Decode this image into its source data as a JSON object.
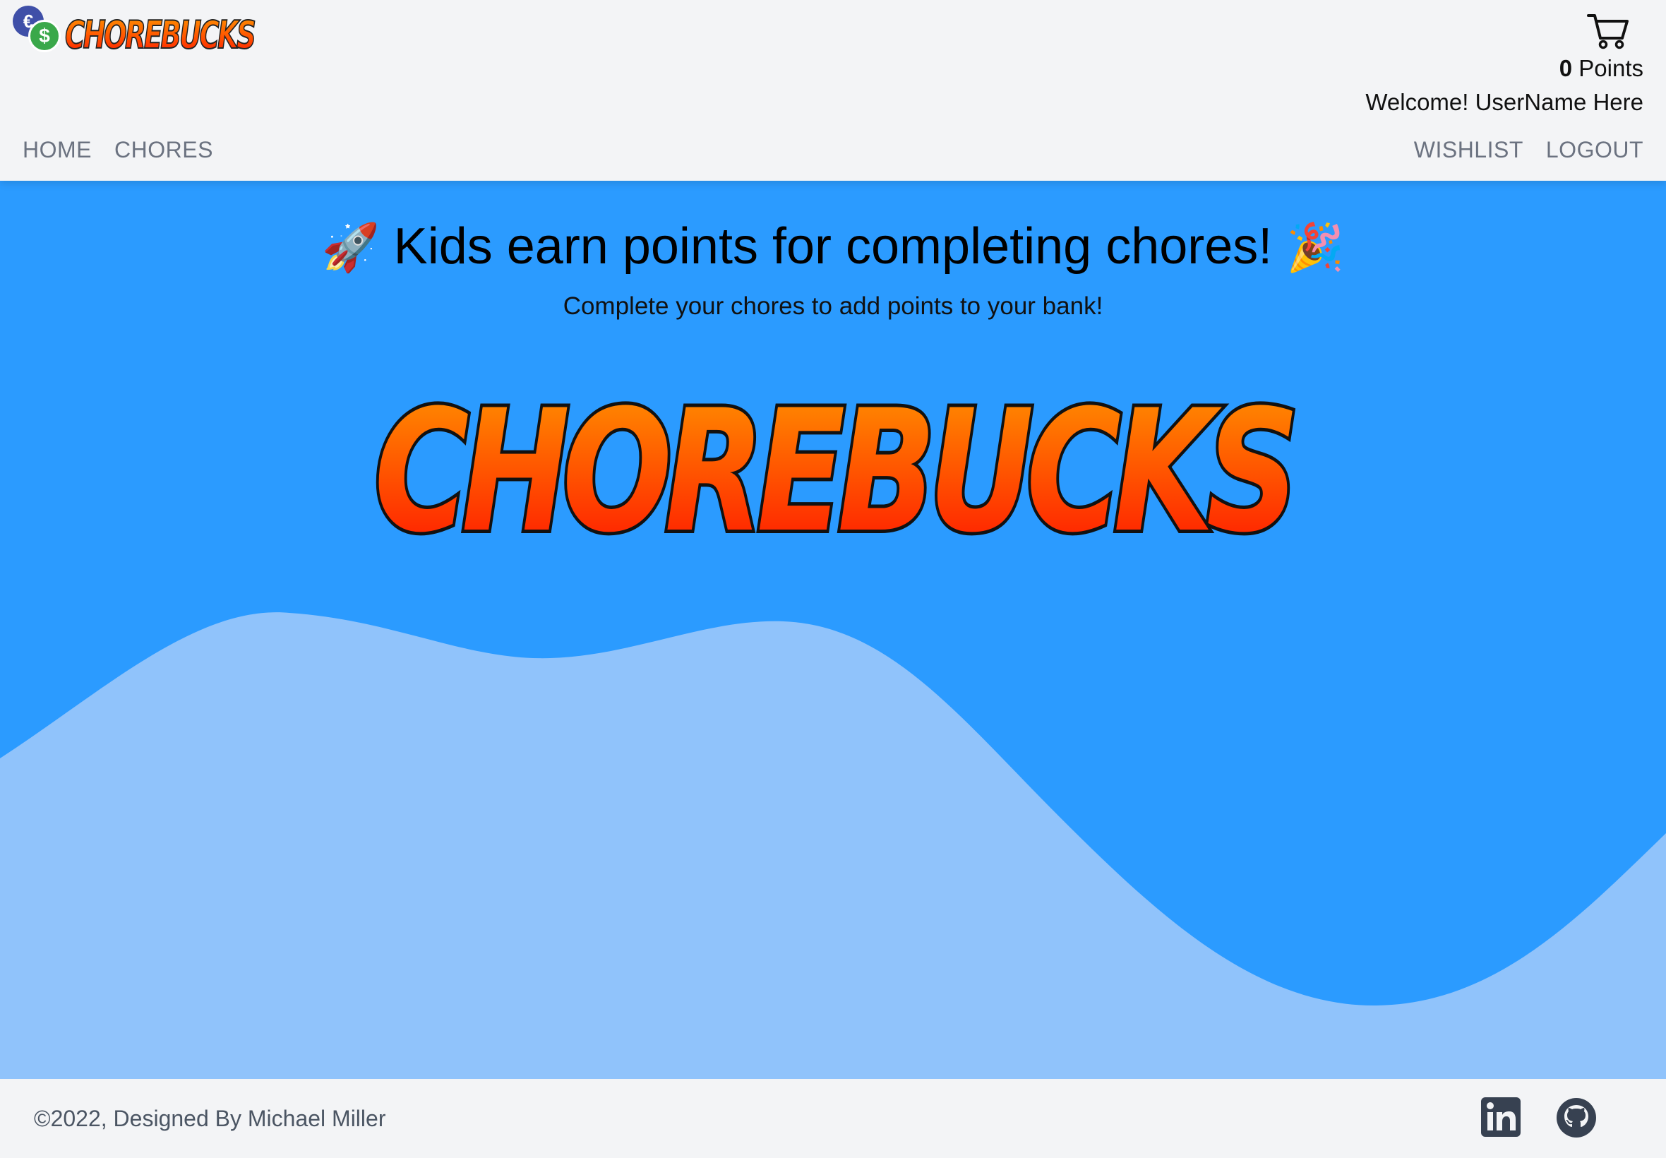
{
  "header": {
    "logo_text": "CHOREBUCKS",
    "coin_euro": "€",
    "coin_dollar": "$",
    "points_value": "0",
    "points_label": " Points",
    "welcome": "Welcome! UserName Here",
    "nav_left": [
      "HOME",
      "CHORES"
    ],
    "nav_right": [
      "WISHLIST",
      "LOGOUT"
    ],
    "cart_icon": "shopping-cart-icon"
  },
  "hero": {
    "emoji_left": "🚀",
    "title": "Kids earn points for completing chores!",
    "emoji_right": "🎉",
    "subtitle": "Complete your chores to add points to your bank!",
    "big_logo_text": "CHOREBUCKS"
  },
  "footer": {
    "copyright": "©2022, Designed By Michael Miller",
    "icons": [
      "linkedin-icon",
      "github-icon"
    ]
  },
  "colors": {
    "hero_bg": "#2b9bff",
    "wave": "#90c3fb",
    "header_bg": "#f3f4f6",
    "logo_top": "#ff9800",
    "logo_bottom": "#ff1a00"
  }
}
